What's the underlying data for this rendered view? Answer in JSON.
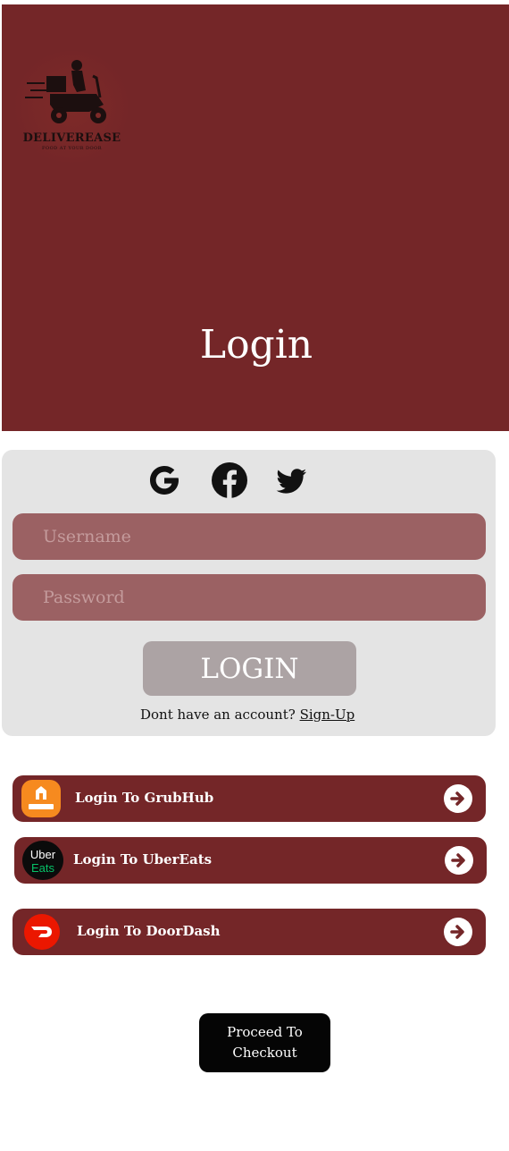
{
  "brand": {
    "name": "DELIVEREASE",
    "tagline": "FOOD AT YOUR DOOR"
  },
  "hero": {
    "title": "Login"
  },
  "login_form": {
    "social": [
      "google-icon",
      "facebook-icon",
      "twitter-icon"
    ],
    "username_placeholder": "Username",
    "password_placeholder": "Password",
    "submit_label": "LOGIN",
    "signup_prompt": "Dont have an account?",
    "signup_link": "Sign-Up"
  },
  "partners": [
    {
      "label": "Login To GrubHub",
      "icon": "grubhub-icon",
      "accent": "#f68a1f"
    },
    {
      "label": "Login To UberEats",
      "icon": "ubereats-icon",
      "accent": "#06c167"
    },
    {
      "label": "Login To DoorDash",
      "icon": "doordash-icon",
      "accent": "#eb1700"
    }
  ],
  "checkout": {
    "label_line1": "Proceed To",
    "label_line2": "Checkout"
  },
  "colors": {
    "primary": "#742628",
    "field": "#9b6163",
    "card": "#e4e4e4",
    "button": "#aca3a4"
  }
}
